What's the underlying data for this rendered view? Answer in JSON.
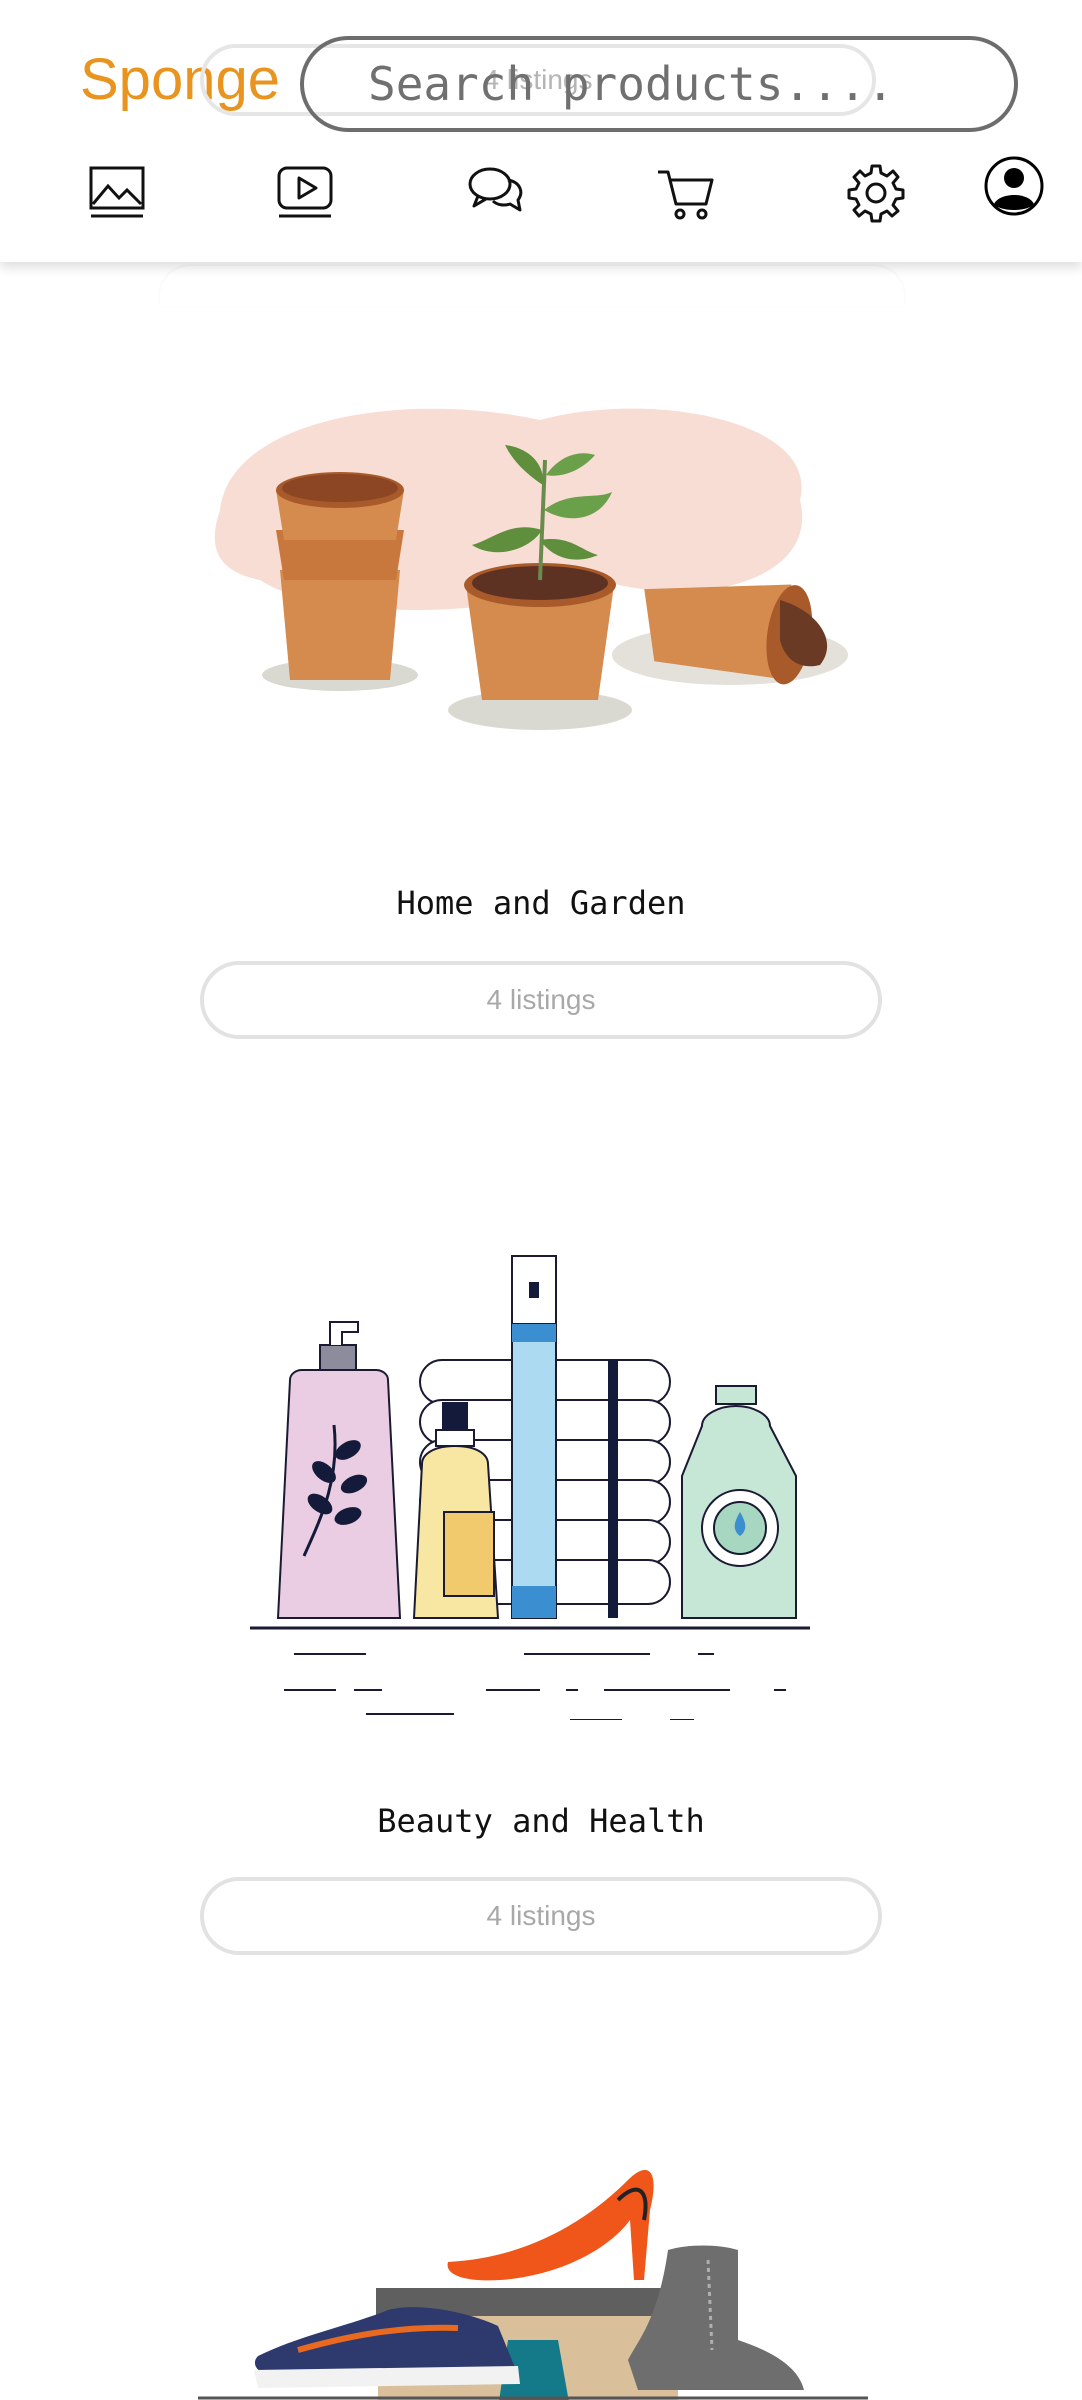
{
  "header": {
    "logo": "Sponge",
    "ghost_listing_label": "4 listings",
    "search": {
      "placeholder": "Search products....",
      "value": ""
    },
    "nav_icons": [
      "image-icon",
      "video-icon",
      "chat-icon",
      "cart-icon",
      "gear-icon",
      "profile-icon"
    ]
  },
  "colors": {
    "brand": "#e8941f",
    "pill_border": "#e2e2e2",
    "pill_text": "#a8a8a8"
  },
  "categories": [
    {
      "title": "Home and Garden",
      "listings": "4 listings",
      "illustration": "flower-pots"
    },
    {
      "title": "Beauty and Health",
      "listings": "4 listings",
      "illustration": "cosmetic-bottles"
    },
    {
      "illustration": "shoes"
    }
  ]
}
